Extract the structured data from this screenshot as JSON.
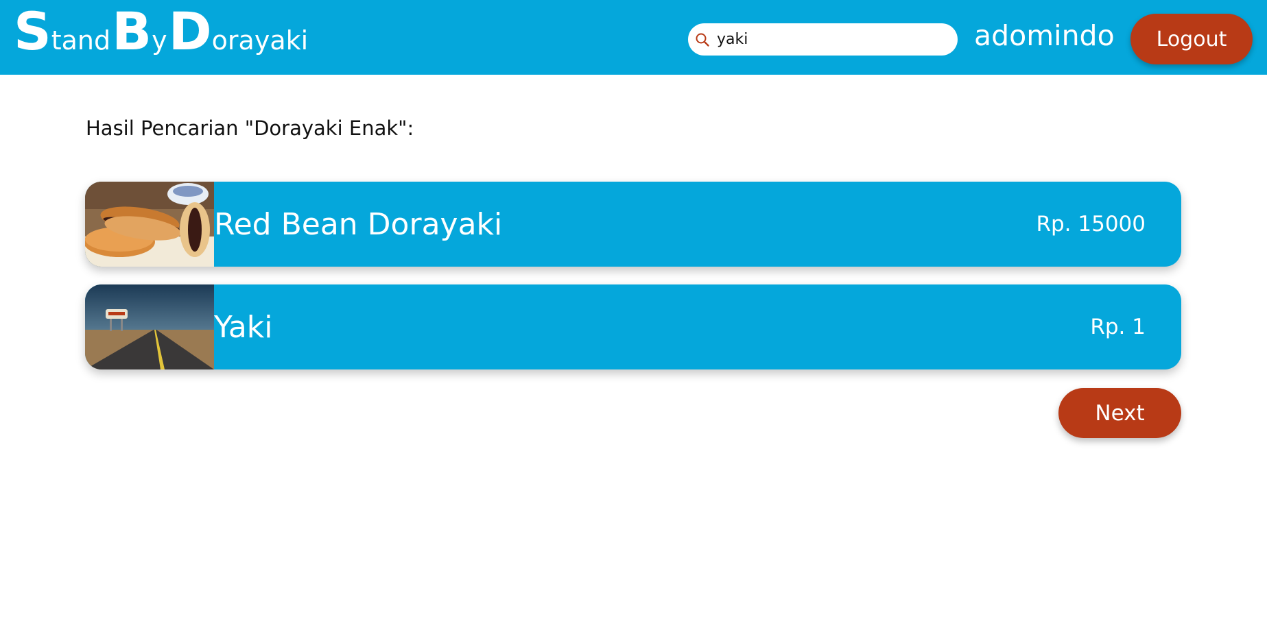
{
  "header": {
    "logo": {
      "s": "S",
      "tand": "tand",
      "b": "B",
      "y": "y",
      "d": "D",
      "orayaki": "orayaki"
    },
    "search": {
      "value": "yaki",
      "icon": "search-icon"
    },
    "username": "adomindo",
    "logout_label": "Logout"
  },
  "main": {
    "results_heading": "Hasil Pencarian \"Dorayaki Enak\":",
    "items": [
      {
        "name": "Red Bean Dorayaki",
        "price": "Rp. 15000",
        "thumb": "dorayaki-photo"
      },
      {
        "name": "Yaki",
        "price": "Rp. 1",
        "thumb": "las-vegas-road-photo"
      }
    ],
    "next_label": "Next"
  },
  "colors": {
    "primary": "#05a7db",
    "accent": "#b83a16",
    "background": "#ffffff"
  }
}
